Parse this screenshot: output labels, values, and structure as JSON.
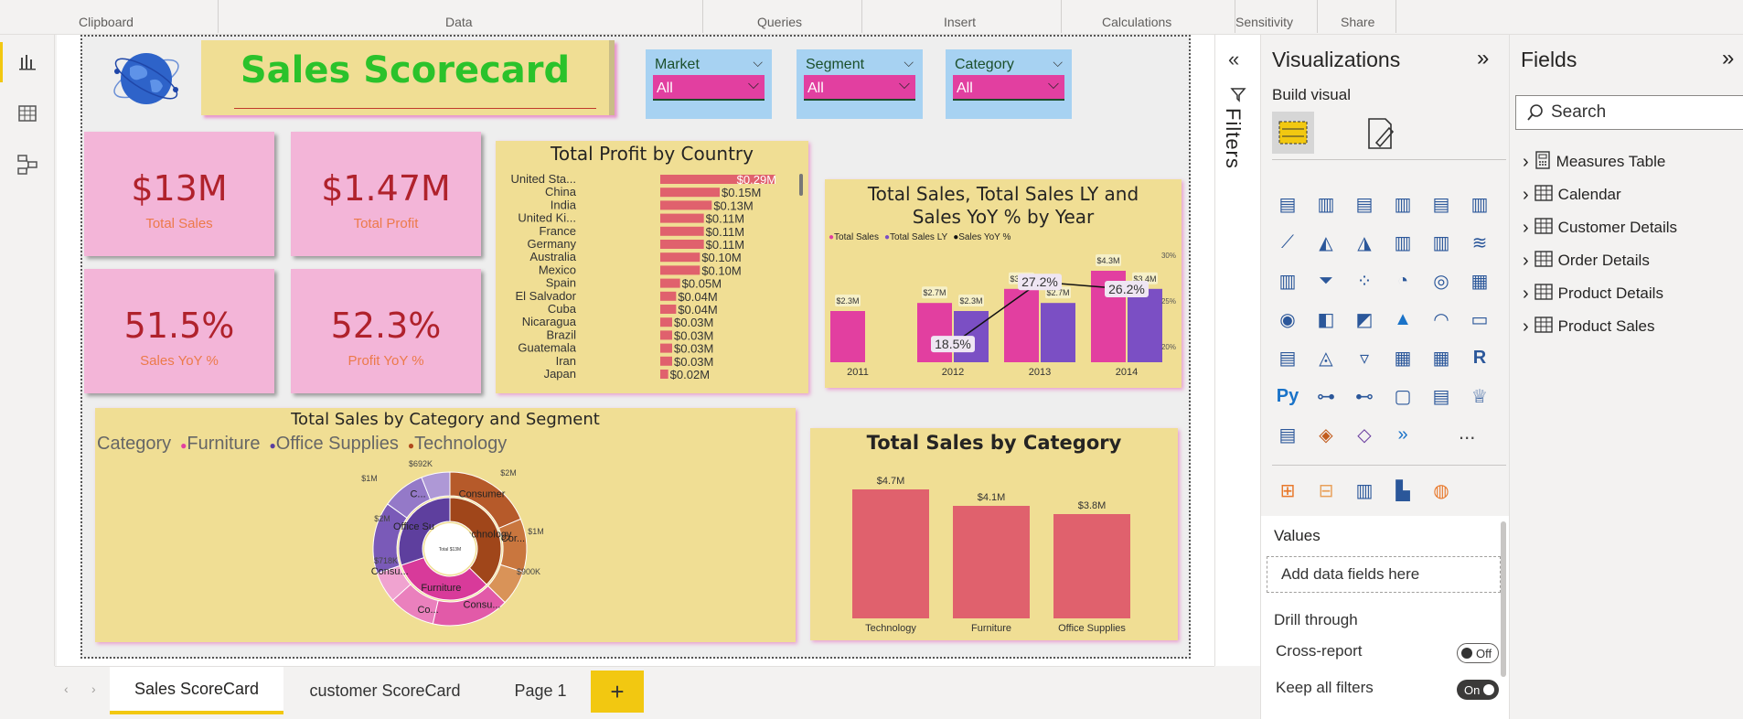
{
  "ribbon": {
    "groups": [
      "Clipboard",
      "Data",
      "Queries",
      "Insert",
      "Calculations",
      "Sensitivity",
      "Share"
    ]
  },
  "rail": {
    "icons": [
      "report-view-icon",
      "table-view-icon",
      "model-view-icon"
    ]
  },
  "report": {
    "title": "Sales Scorecard",
    "slicers": [
      {
        "title": "Market",
        "value": "All"
      },
      {
        "title": "Segment",
        "value": "All"
      },
      {
        "title": "Category",
        "value": "All"
      }
    ],
    "cards": [
      {
        "value": "$13M",
        "label": "Total Sales"
      },
      {
        "value": "$1.47M",
        "label": "Total  Profit"
      },
      {
        "value": "51.5%",
        "label": "Sales YoY %"
      },
      {
        "value": "52.3%",
        "label": "Profit YoY %"
      }
    ],
    "colors": {
      "card": "#f3b5d8",
      "panel": "#f0de94",
      "bar": "#e0616d",
      "pink": "#e23fa0",
      "purple": "#7b4fc4"
    }
  },
  "chart_data": [
    {
      "type": "bar",
      "orientation": "horizontal",
      "title": "Total Profit by Country",
      "categories": [
        "United Sta...",
        "China",
        "India",
        "United Ki...",
        "France",
        "Germany",
        "Australia",
        "Mexico",
        "Spain",
        "El Salvador",
        "Cuba",
        "Nicaragua",
        "Brazil",
        "Guatemala",
        "Iran",
        "Japan"
      ],
      "values": [
        0.29,
        0.15,
        0.13,
        0.11,
        0.11,
        0.11,
        0.1,
        0.1,
        0.05,
        0.04,
        0.04,
        0.03,
        0.03,
        0.03,
        0.03,
        0.02
      ],
      "labels": [
        "$0.29M",
        "$0.15M",
        "$0.13M",
        "$0.11M",
        "$0.11M",
        "$0.11M",
        "$0.10M",
        "$0.10M",
        "$0.05M",
        "$0.04M",
        "$0.04M",
        "$0.03M",
        "$0.03M",
        "$0.03M",
        "$0.03M",
        "$0.02M"
      ]
    },
    {
      "type": "bar",
      "title": "Total Sales, Total Sales LY and Sales YoY % by Year",
      "categories": [
        "2011",
        "2012",
        "2013",
        "2014"
      ],
      "series": [
        {
          "name": "Total Sales",
          "values": [
            2.3,
            2.7,
            3.4,
            4.3
          ],
          "labels": [
            "$2.3M",
            "$2.7M",
            "$3.4M",
            "$4.3M"
          ]
        },
        {
          "name": "Total Sales LY",
          "values": [
            null,
            2.3,
            2.7,
            3.4
          ],
          "labels": [
            "",
            "$2.3M",
            "$2.7M",
            "$3.4M"
          ]
        },
        {
          "name": "Sales YoY %",
          "type": "line",
          "values": [
            null,
            18.5,
            27.2,
            26.2
          ],
          "labels": [
            "",
            "18.5%",
            "27.2%",
            "26.2%"
          ]
        }
      ],
      "y2_ticks": [
        "30%",
        "25%",
        "20%"
      ]
    },
    {
      "type": "pie",
      "subtype": "sunburst",
      "title": "Total Sales by Category and Segment",
      "legend_title": "Category",
      "legend": [
        "Furniture",
        "Office Supplies",
        "Technology"
      ],
      "center_label": "Total $13M",
      "inner": [
        {
          "name": "Technology",
          "value": 4.7
        },
        {
          "name": "Furniture",
          "value": 4.1
        },
        {
          "name": "Office Su...",
          "value": 3.8
        }
      ],
      "outer_labels": [
        "Consumer",
        "Cor...",
        "Consu...",
        "Co...",
        "Consu...",
        "C..."
      ],
      "value_labels": [
        "$2M",
        "$1M",
        "$900K",
        "$718K",
        "$2M",
        "$1M",
        "$692K"
      ]
    },
    {
      "type": "bar",
      "title": "Total Sales by Category",
      "categories": [
        "Technology",
        "Furniture",
        "Office Supplies"
      ],
      "values": [
        4.7,
        4.1,
        3.8
      ],
      "labels": [
        "$4.7M",
        "$4.1M",
        "$3.8M"
      ]
    }
  ],
  "filters_pane": {
    "label": "Filters"
  },
  "visualizations": {
    "title": "Visualizations",
    "build_visual": "Build visual",
    "values_label": "Values",
    "add_fields": "Add data fields here",
    "drill_through": "Drill through",
    "cross_report": "Cross-report",
    "cross_report_state": "Off",
    "keep_filters": "Keep all filters",
    "keep_filters_state": "On",
    "more": "..."
  },
  "fields": {
    "title": "Fields",
    "search_placeholder": "Search",
    "tables": [
      "Measures Table",
      "Calendar",
      "Customer Details",
      "Order Details",
      "Product Details",
      "Product Sales"
    ]
  },
  "tabs": [
    {
      "label": "Sales ScoreCard",
      "active": true
    },
    {
      "label": "customer ScoreCard",
      "active": false
    },
    {
      "label": "Page 1",
      "active": false
    }
  ],
  "add_page": "+"
}
